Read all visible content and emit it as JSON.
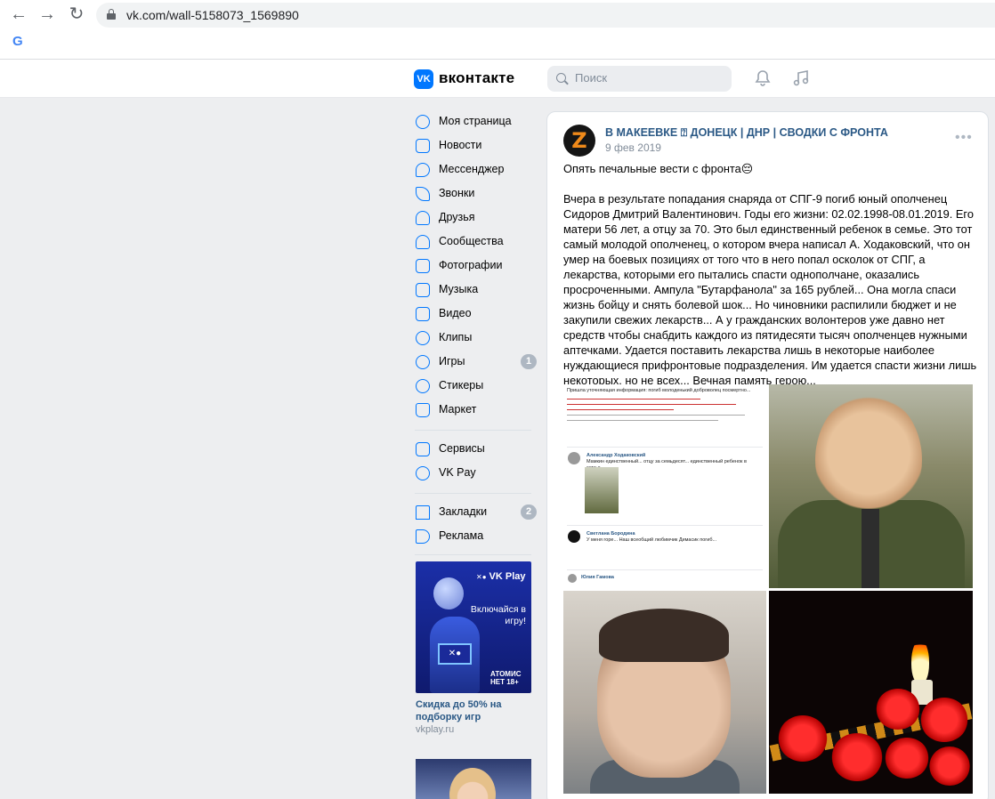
{
  "browser": {
    "url": "vk.com/wall-5158073_1569890",
    "bookmark_icon": "G"
  },
  "header": {
    "logo": "VK",
    "brand": "вконтакте",
    "search_placeholder": "Поиск"
  },
  "sidebar": {
    "items": [
      {
        "label": "Моя страница",
        "icon": "user-circle-icon"
      },
      {
        "label": "Новости",
        "icon": "news-icon"
      },
      {
        "label": "Мессенджер",
        "icon": "message-icon"
      },
      {
        "label": "Звонки",
        "icon": "phone-icon"
      },
      {
        "label": "Друзья",
        "icon": "friends-icon"
      },
      {
        "label": "Сообщества",
        "icon": "communities-icon"
      },
      {
        "label": "Фотографии",
        "icon": "photo-icon"
      },
      {
        "label": "Музыка",
        "icon": "music-icon"
      },
      {
        "label": "Видео",
        "icon": "video-icon"
      },
      {
        "label": "Клипы",
        "icon": "clips-icon"
      },
      {
        "label": "Игры",
        "icon": "games-icon",
        "badge": "1"
      },
      {
        "label": "Стикеры",
        "icon": "sticker-icon"
      },
      {
        "label": "Маркет",
        "icon": "market-icon"
      },
      {
        "label": "Сервисы",
        "icon": "services-icon"
      },
      {
        "label": "VK Pay",
        "icon": "vkpay-icon"
      },
      {
        "label": "Закладки",
        "icon": "bookmark-icon",
        "badge": "2"
      },
      {
        "label": "Реклама",
        "icon": "ads-icon"
      }
    ]
  },
  "ad": {
    "logo": "VK Play",
    "text": "Включайся в игру!",
    "screen": "✕●",
    "game": "АТОМИС НЕТ 18+",
    "title": "Скидка до 50% на подборку игр",
    "domain": "vkplay.ru"
  },
  "post": {
    "avatar_letter": "Z",
    "group_name": "В МАКЕЕВКЕ ⍰ ДОНЕЦК | ДНР | СВОДКИ С ФРОНТА",
    "date": "9 фев 2019",
    "more": "•••",
    "text": "Опять печальные вести с фронта😔\n\nВчера в результате попадания снаряда от СПГ-9 погиб юный ополченец Сидоров Дмитрий Валентинович. Годы его жизни: 02.02.1998-08.01.2019. Его матери 56 лет, а отцу за 70. Это был единственный ребенок в семье. Это тот самый молодой ополченец, о котором вчера написал А. Ходаковский, что он умер на боевых позициях от того что в него попал осколок от СПГ, а лекарства, которыми его пытались спасти однополчане, оказались просроченными. Ампула \"Бутарфанола\" за 165 рублей... Она могла спаси жизнь бойцу и снять болевой шок... Но чиновники распилили бюджет и не закупили свежих лекарств... А у гражданских волонтеров уже давно нет средств чтобы снабдить каждого из пятидесяти тысяч ополченцев нужными аптечками. Удается поставить лекарства лишь в некоторые наиболее нуждающиеся прифронтовые подразделения. Им удается спасти жизни лишь некоторых, но не всех... Вечная память герою...",
    "screenshot": {
      "intro": "Пришла уточняющая информация: погиб молоденький доброволец посмертно...",
      "author1": "Александр Ходаковский",
      "reply1": "Мамкин единственный... отцу за семьдесят... единственный ребенок в семье.",
      "author2": "Светлана Бородина",
      "reply2": "У меня горе... Наш всеобщий любимчик Димасик погиб...",
      "author3": "Юлия Гамова"
    }
  }
}
